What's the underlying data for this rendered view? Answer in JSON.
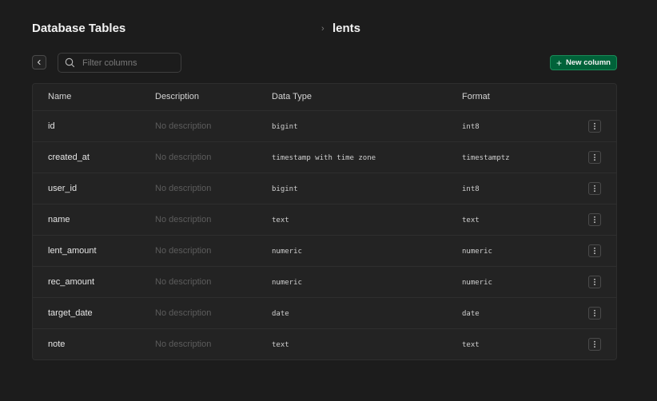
{
  "header": {
    "title": "Database Tables",
    "breadcrumb_separator": "›",
    "table_name": "lents"
  },
  "toolbar": {
    "search_placeholder": "Filter columns",
    "search_value": "",
    "new_column_label": "New column"
  },
  "table": {
    "headers": [
      "Name",
      "Description",
      "Data Type",
      "Format"
    ],
    "rows": [
      {
        "name": "id",
        "description": "No description",
        "data_type": "bigint",
        "format": "int8"
      },
      {
        "name": "created_at",
        "description": "No description",
        "data_type": "timestamp with time zone",
        "format": "timestamptz"
      },
      {
        "name": "user_id",
        "description": "No description",
        "data_type": "bigint",
        "format": "int8"
      },
      {
        "name": "name",
        "description": "No description",
        "data_type": "text",
        "format": "text"
      },
      {
        "name": "lent_amount",
        "description": "No description",
        "data_type": "numeric",
        "format": "numeric"
      },
      {
        "name": "rec_amount",
        "description": "No description",
        "data_type": "numeric",
        "format": "numeric"
      },
      {
        "name": "target_date",
        "description": "No description",
        "data_type": "date",
        "format": "date"
      },
      {
        "name": "note",
        "description": "No description",
        "data_type": "text",
        "format": "text"
      }
    ]
  },
  "colors": {
    "background": "#1c1c1c",
    "table_background": "#232323",
    "accent_green": "#006239"
  }
}
